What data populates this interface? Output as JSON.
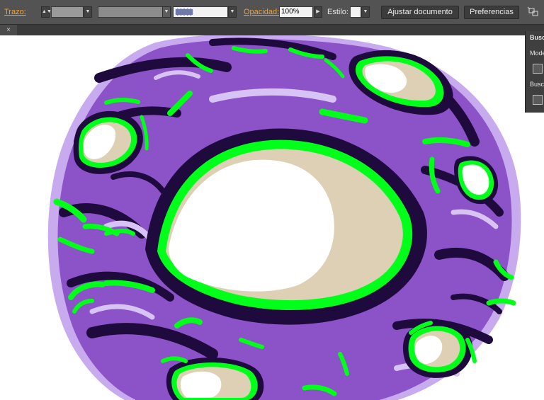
{
  "control_bar": {
    "stroke_label": "Trazo:",
    "opacity_label": "Opacidad:",
    "opacity_value": "100%",
    "style_label": "Estilo:",
    "adjust_document_button": "Ajustar documento",
    "preferences_button": "Preferencias",
    "arrange_icon": "arrange-documents-icon"
  },
  "tab_bar": {
    "close_glyph": "×"
  },
  "side_panel": {
    "title": "Busc",
    "mode_label": "Mode",
    "section_label": "Busc"
  },
  "colors": {
    "ui_dark": "#535353",
    "ui_accent_label": "#f0a030",
    "art_purple": "#8c52c8",
    "art_dark": "#1e0a3c",
    "art_green": "#00ff19",
    "art_cream": "#ddd0b4",
    "art_lavender": "#c8aaee"
  }
}
